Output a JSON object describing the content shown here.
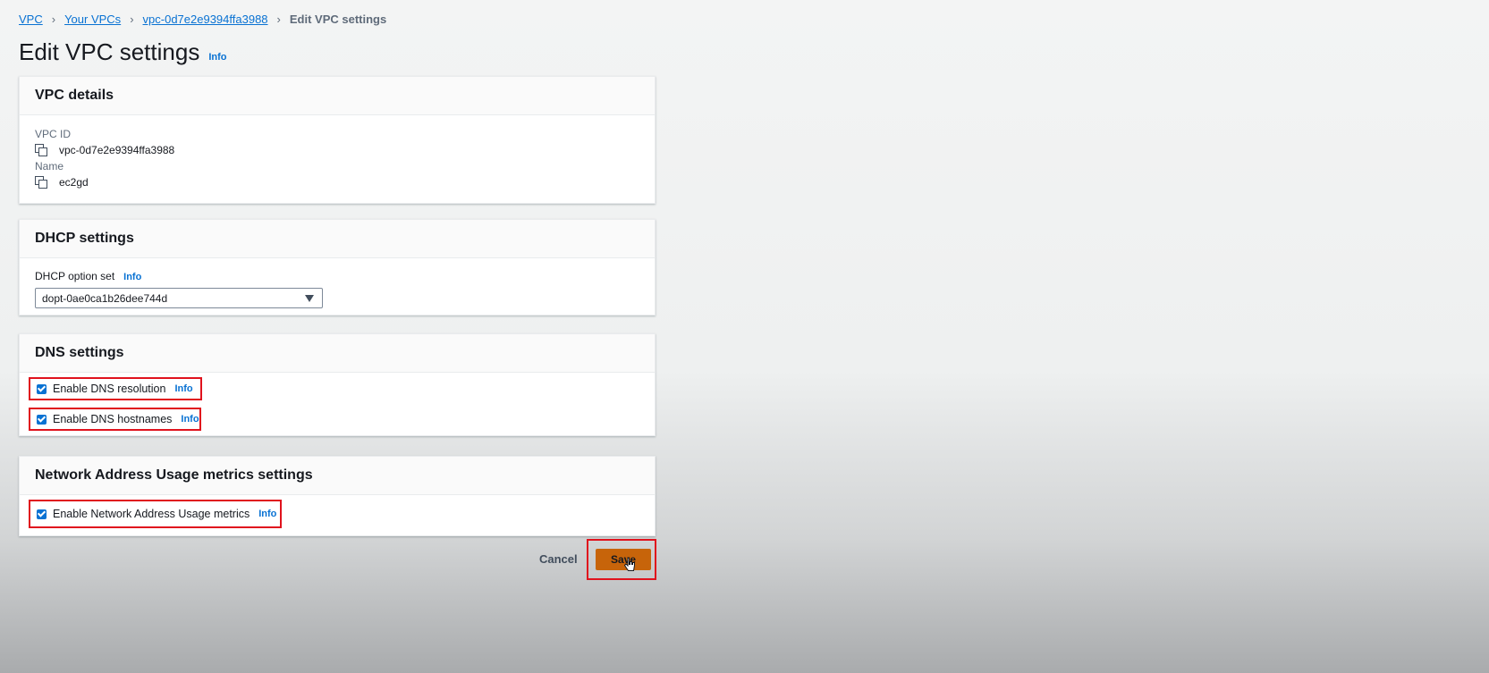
{
  "breadcrumb": {
    "items": [
      "VPC",
      "Your VPCs",
      "vpc-0d7e2e9394ffa3988"
    ],
    "current": "Edit VPC settings"
  },
  "page": {
    "title": "Edit VPC settings",
    "info": "Info"
  },
  "vpc_details": {
    "heading": "VPC details",
    "vpc_id_label": "VPC ID",
    "vpc_id_value": "vpc-0d7e2e9394ffa3988",
    "name_label": "Name",
    "name_value": "ec2gd"
  },
  "dhcp": {
    "heading": "DHCP settings",
    "option_set_label": "DHCP option set",
    "info": "Info",
    "selected": "dopt-0ae0ca1b26dee744d"
  },
  "dns": {
    "heading": "DNS settings",
    "resolution_label": "Enable DNS resolution",
    "hostnames_label": "Enable DNS hostnames",
    "info": "Info"
  },
  "nau": {
    "heading": "Network Address Usage metrics settings",
    "metrics_label": "Enable Network Address Usage metrics",
    "info": "Info"
  },
  "actions": {
    "cancel": "Cancel",
    "save": "Save"
  },
  "colors": {
    "link": "#0972d3",
    "primary_button": "#c7640a",
    "highlight": "#e0121d"
  },
  "icons": {
    "separator": "chevron-right-icon",
    "copy": "copy-icon",
    "dropdown": "caret-down-icon",
    "checkbox": "checkbox-checked-icon",
    "cursor": "hand-pointer-icon"
  }
}
